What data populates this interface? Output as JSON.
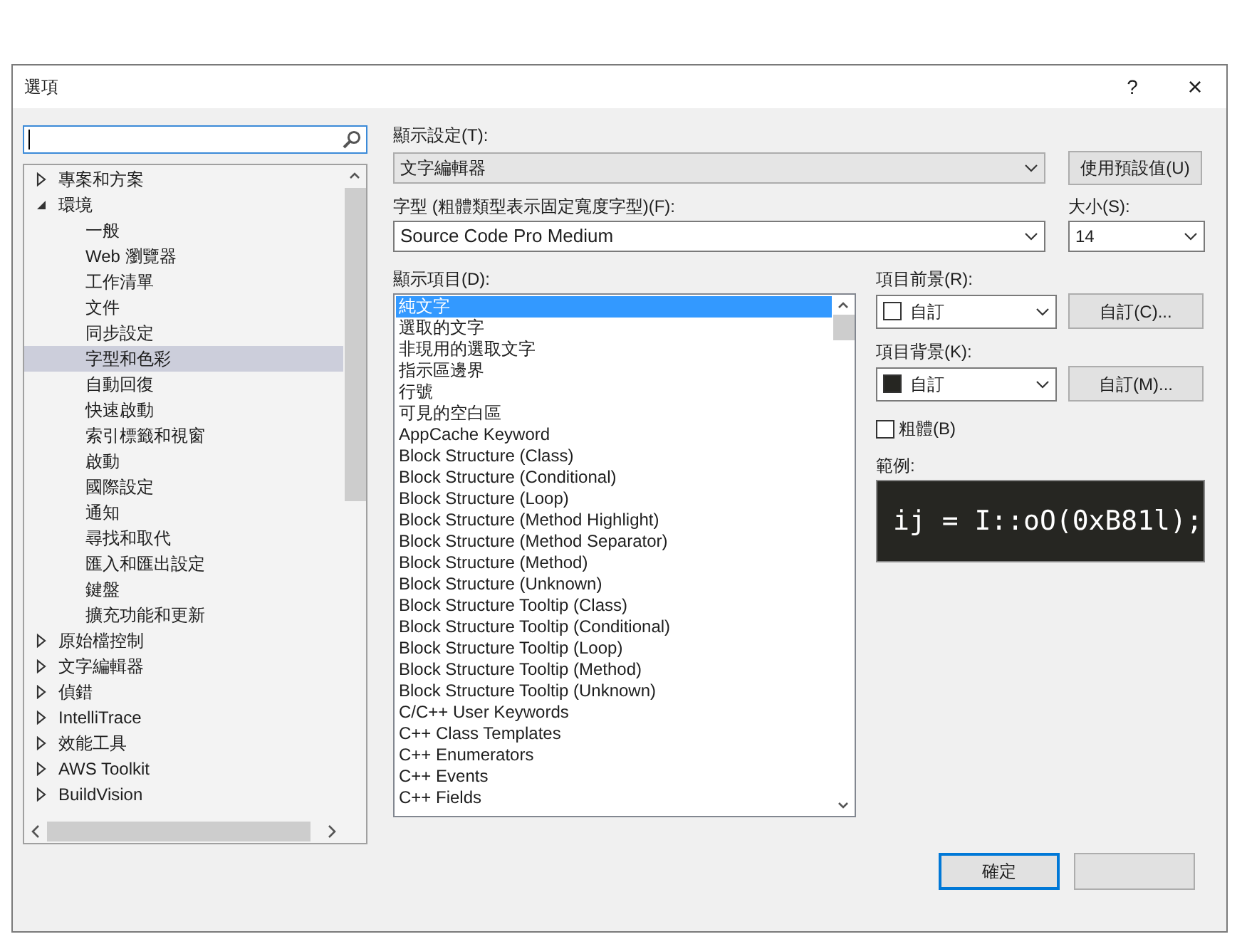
{
  "window": {
    "title": "選項",
    "help": "?",
    "close": "×"
  },
  "tree": [
    {
      "label": "專案和方案",
      "expanded": false,
      "selected": false
    },
    {
      "label": "環境",
      "expanded": true,
      "selected": false,
      "children": [
        {
          "label": "一般",
          "selected": false
        },
        {
          "label": "Web 瀏覽器",
          "selected": false
        },
        {
          "label": "工作清單",
          "selected": false
        },
        {
          "label": "文件",
          "selected": false
        },
        {
          "label": "同步設定",
          "selected": false
        },
        {
          "label": "字型和色彩",
          "selected": true
        },
        {
          "label": "自動回復",
          "selected": false
        },
        {
          "label": "快速啟動",
          "selected": false
        },
        {
          "label": "索引標籤和視窗",
          "selected": false
        },
        {
          "label": "啟動",
          "selected": false
        },
        {
          "label": "國際設定",
          "selected": false
        },
        {
          "label": "通知",
          "selected": false
        },
        {
          "label": "尋找和取代",
          "selected": false
        },
        {
          "label": "匯入和匯出設定",
          "selected": false
        },
        {
          "label": "鍵盤",
          "selected": false
        },
        {
          "label": "擴充功能和更新",
          "selected": false
        }
      ]
    },
    {
      "label": "原始檔控制",
      "expanded": false,
      "selected": false
    },
    {
      "label": "文字編輯器",
      "expanded": false,
      "selected": false
    },
    {
      "label": "偵錯",
      "expanded": false,
      "selected": false
    },
    {
      "label": "IntelliTrace",
      "expanded": false,
      "selected": false
    },
    {
      "label": "效能工具",
      "expanded": false,
      "selected": false
    },
    {
      "label": "AWS Toolkit",
      "expanded": false,
      "selected": false
    },
    {
      "label": "BuildVision",
      "expanded": false,
      "selected": false
    }
  ],
  "show_settings": {
    "label": "顯示設定(T):",
    "value": "文字編輯器",
    "reset_button": "使用預設值(U)"
  },
  "font": {
    "label": "字型 (粗體類型表示固定寬度字型)(F):",
    "value": "Source Code Pro Medium"
  },
  "size": {
    "label": "大小(S):",
    "value": "14"
  },
  "display_items": {
    "label": "顯示項目(D):",
    "items": [
      {
        "label": "純文字",
        "selected": true
      },
      {
        "label": "選取的文字",
        "selected": false
      },
      {
        "label": "非現用的選取文字",
        "selected": false
      },
      {
        "label": "指示區邊界",
        "selected": false
      },
      {
        "label": "行號",
        "selected": false
      },
      {
        "label": "可見的空白區",
        "selected": false
      },
      {
        "label": "AppCache Keyword",
        "selected": false
      },
      {
        "label": "Block Structure (Class)",
        "selected": false
      },
      {
        "label": "Block Structure (Conditional)",
        "selected": false
      },
      {
        "label": "Block Structure (Loop)",
        "selected": false
      },
      {
        "label": "Block Structure (Method Highlight)",
        "selected": false
      },
      {
        "label": "Block Structure (Method Separator)",
        "selected": false
      },
      {
        "label": "Block Structure (Method)",
        "selected": false
      },
      {
        "label": "Block Structure (Unknown)",
        "selected": false
      },
      {
        "label": "Block Structure Tooltip (Class)",
        "selected": false
      },
      {
        "label": "Block Structure Tooltip (Conditional)",
        "selected": false
      },
      {
        "label": "Block Structure Tooltip (Loop)",
        "selected": false
      },
      {
        "label": "Block Structure Tooltip (Method)",
        "selected": false
      },
      {
        "label": "Block Structure Tooltip (Unknown)",
        "selected": false
      },
      {
        "label": "C/C++ User Keywords",
        "selected": false
      },
      {
        "label": "C++ Class Templates",
        "selected": false
      },
      {
        "label": "C++ Enumerators",
        "selected": false
      },
      {
        "label": "C++ Events",
        "selected": false
      },
      {
        "label": "C++ Fields",
        "selected": false
      }
    ]
  },
  "foreground": {
    "label": "項目前景(R):",
    "value": "自訂",
    "color": "#ffffff",
    "button": "自訂(C)..."
  },
  "background": {
    "label": "項目背景(K):",
    "value": "自訂",
    "color": "#262622",
    "button": "自訂(M)..."
  },
  "bold": {
    "label": "粗體(B)",
    "checked": false
  },
  "sample": {
    "label": "範例:",
    "text": "ij = I::oO(0xB81l);"
  },
  "buttons": [
    {
      "label": "確定",
      "default": true
    },
    {
      "default": false
    }
  ]
}
